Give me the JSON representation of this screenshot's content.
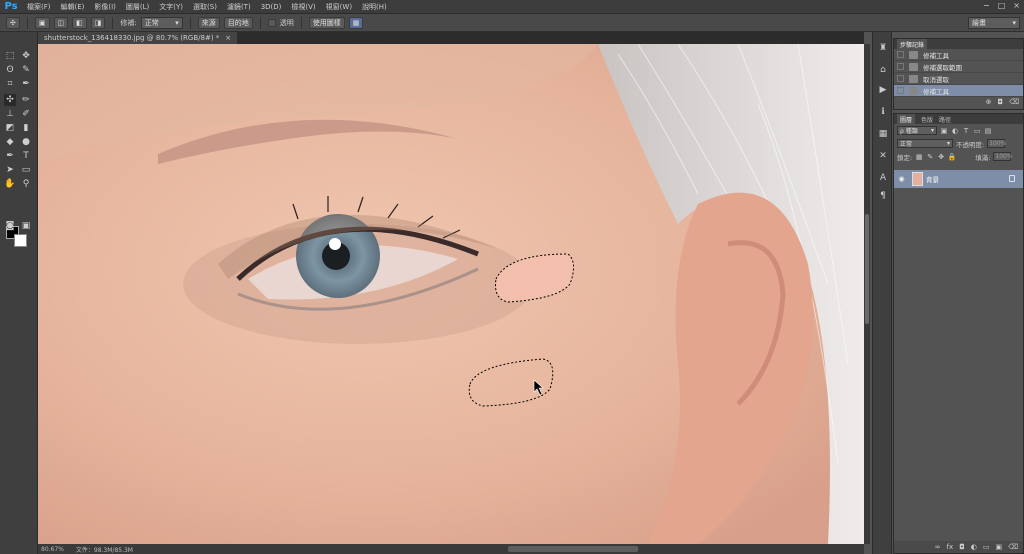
{
  "app": {
    "logo": "Ps"
  },
  "menubar": {
    "items": [
      "檔案(F)",
      "編輯(E)",
      "影像(I)",
      "圖層(L)",
      "文字(Y)",
      "選取(S)",
      "濾鏡(T)",
      "3D(D)",
      "檢視(V)",
      "視窗(W)",
      "說明(H)"
    ],
    "window_controls": [
      "−",
      "□",
      "×"
    ]
  },
  "options_bar": {
    "repair_label": "修補:",
    "mode_value": "正常",
    "source_button": "來源",
    "destination_button": "目的地",
    "transparent_label": "透明",
    "use_pattern_button": "使用圖樣",
    "workspace_value": "繪畫"
  },
  "document": {
    "tab_title": "shutterstock_136418330.jpg @ 80.7% (RGB/8#) *",
    "tab_close": "×"
  },
  "status_bar": {
    "zoom": "80.67%",
    "doc_size": "文件：98.3M/85.3M"
  },
  "history_panel": {
    "tabs": [
      "步驟記錄"
    ],
    "items": [
      {
        "label": "修補工具",
        "active": false
      },
      {
        "label": "修補選取範圍",
        "active": false
      },
      {
        "label": "取消選取",
        "active": false
      },
      {
        "label": "修補工具",
        "active": true
      }
    ],
    "bottom_icons": [
      "⊕",
      "◘",
      "⌫"
    ]
  },
  "layers_panel": {
    "tabs": [
      "圖層",
      "色版",
      "路徑"
    ],
    "kind_filter": "ρ 種類",
    "blend_mode": "正常",
    "opacity_label": "不透明度:",
    "opacity_value": "100%",
    "lock_label": "鎖定:",
    "fill_label": "填滿:",
    "fill_value": "100%",
    "layer_name": "背景",
    "eye_icon": "👁",
    "bottom_icons": [
      "∞",
      "fx",
      "◘",
      "◐",
      "▭",
      "▣",
      "⌫"
    ]
  },
  "colors": {
    "accent_selected": "#7e8ea8",
    "foreground": "#000000",
    "background": "#ffffff"
  }
}
